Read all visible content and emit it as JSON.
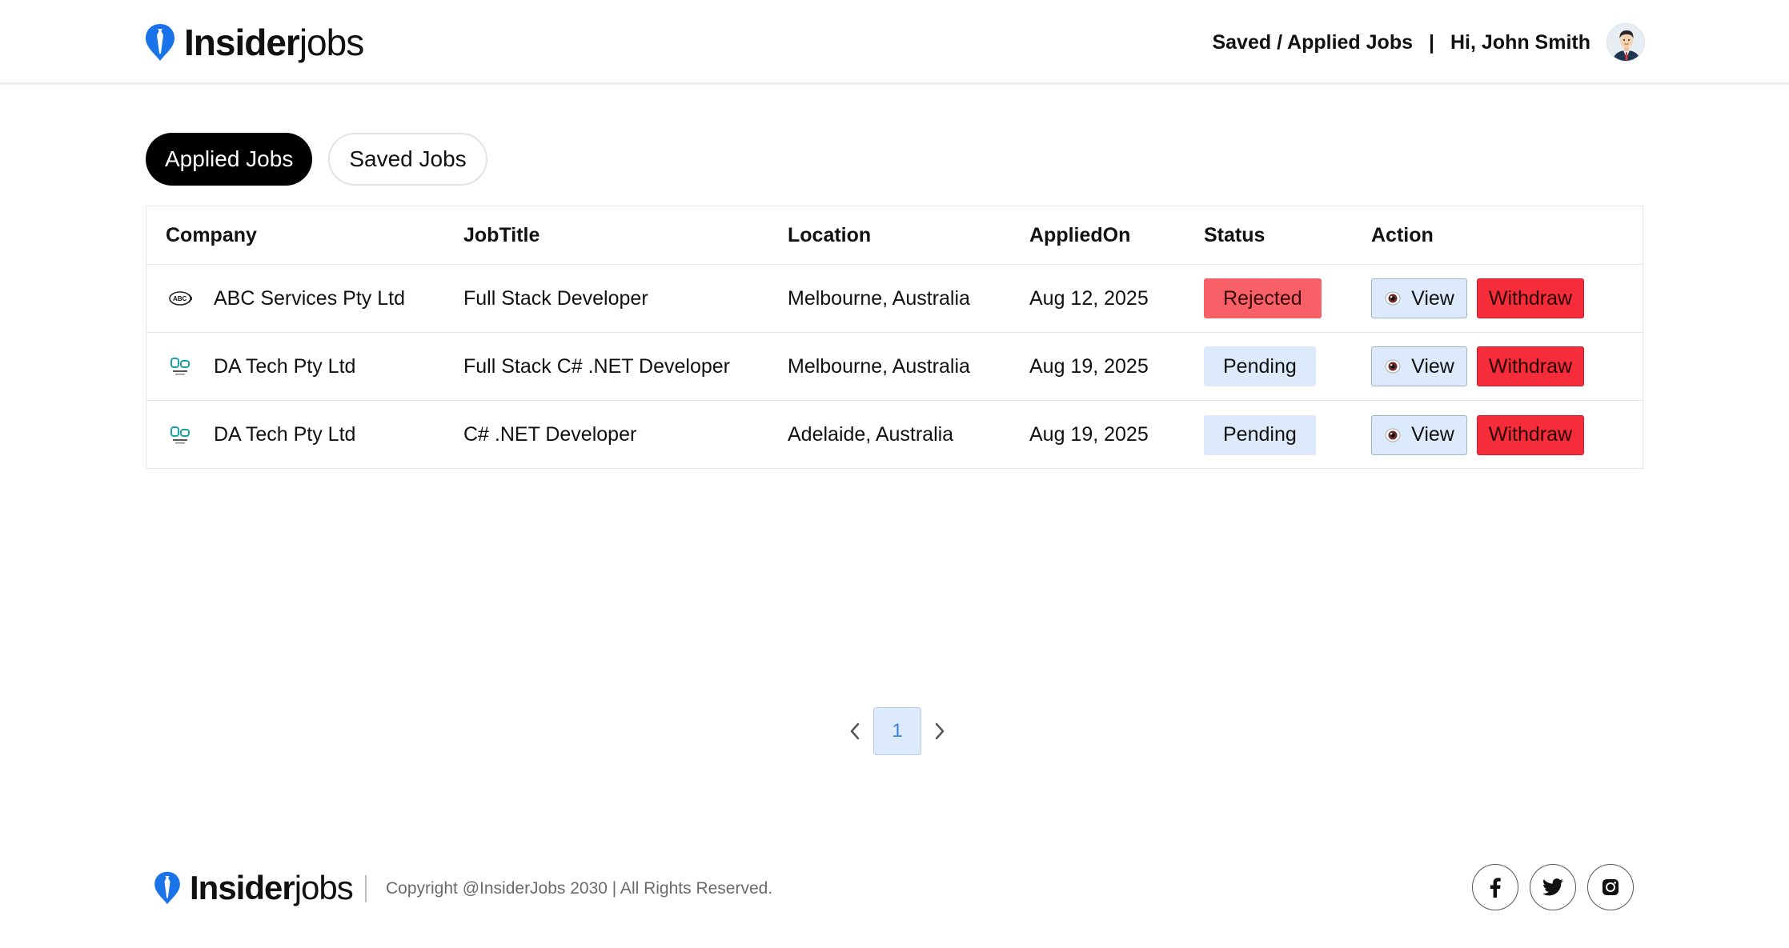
{
  "header": {
    "brand_bold": "Insider",
    "brand_light": "jobs",
    "nav_link": "Saved / Applied Jobs",
    "separator": "|",
    "greeting": "Hi, John Smith"
  },
  "tabs": [
    {
      "label": "Applied Jobs",
      "active": true
    },
    {
      "label": "Saved Jobs",
      "active": false
    }
  ],
  "table": {
    "columns": [
      "Company",
      "JobTitle",
      "Location",
      "AppliedOn",
      "Status",
      "Action"
    ],
    "rows": [
      {
        "company": "ABC Services Pty Ltd",
        "logo": "abc-logo-icon",
        "title": "Full Stack Developer",
        "location": "Melbourne, Australia",
        "applied_on": "Aug 12, 2025",
        "status": "Rejected"
      },
      {
        "company": "DA Tech Pty Ltd",
        "logo": "datech-logo-icon",
        "title": "Full Stack C# .NET Developer",
        "location": "Melbourne, Australia",
        "applied_on": "Aug 19, 2025",
        "status": "Pending"
      },
      {
        "company": "DA Tech Pty Ltd",
        "logo": "datech-logo-icon",
        "title": "C# .NET Developer",
        "location": "Adelaide, Australia",
        "applied_on": "Aug 19, 2025",
        "status": "Pending"
      }
    ],
    "view_label": "View",
    "withdraw_label": "Withdraw"
  },
  "pagination": {
    "current_page": "1",
    "prev_icon": "chevron-left-icon",
    "next_icon": "chevron-right-icon"
  },
  "footer": {
    "brand_bold": "Insider",
    "brand_light": "jobs",
    "copyright": "Copyright @InsiderJobs 2030 | All Rights Reserved.",
    "social_icons": [
      "facebook-icon",
      "twitter-icon",
      "instagram-icon"
    ]
  },
  "colors": {
    "accent_blue": "#1a73e8",
    "rejected_bg": "#f86068",
    "pending_bg": "#dceafb",
    "withdraw_bg": "#f52d3a",
    "active_tab_bg": "#000000"
  }
}
